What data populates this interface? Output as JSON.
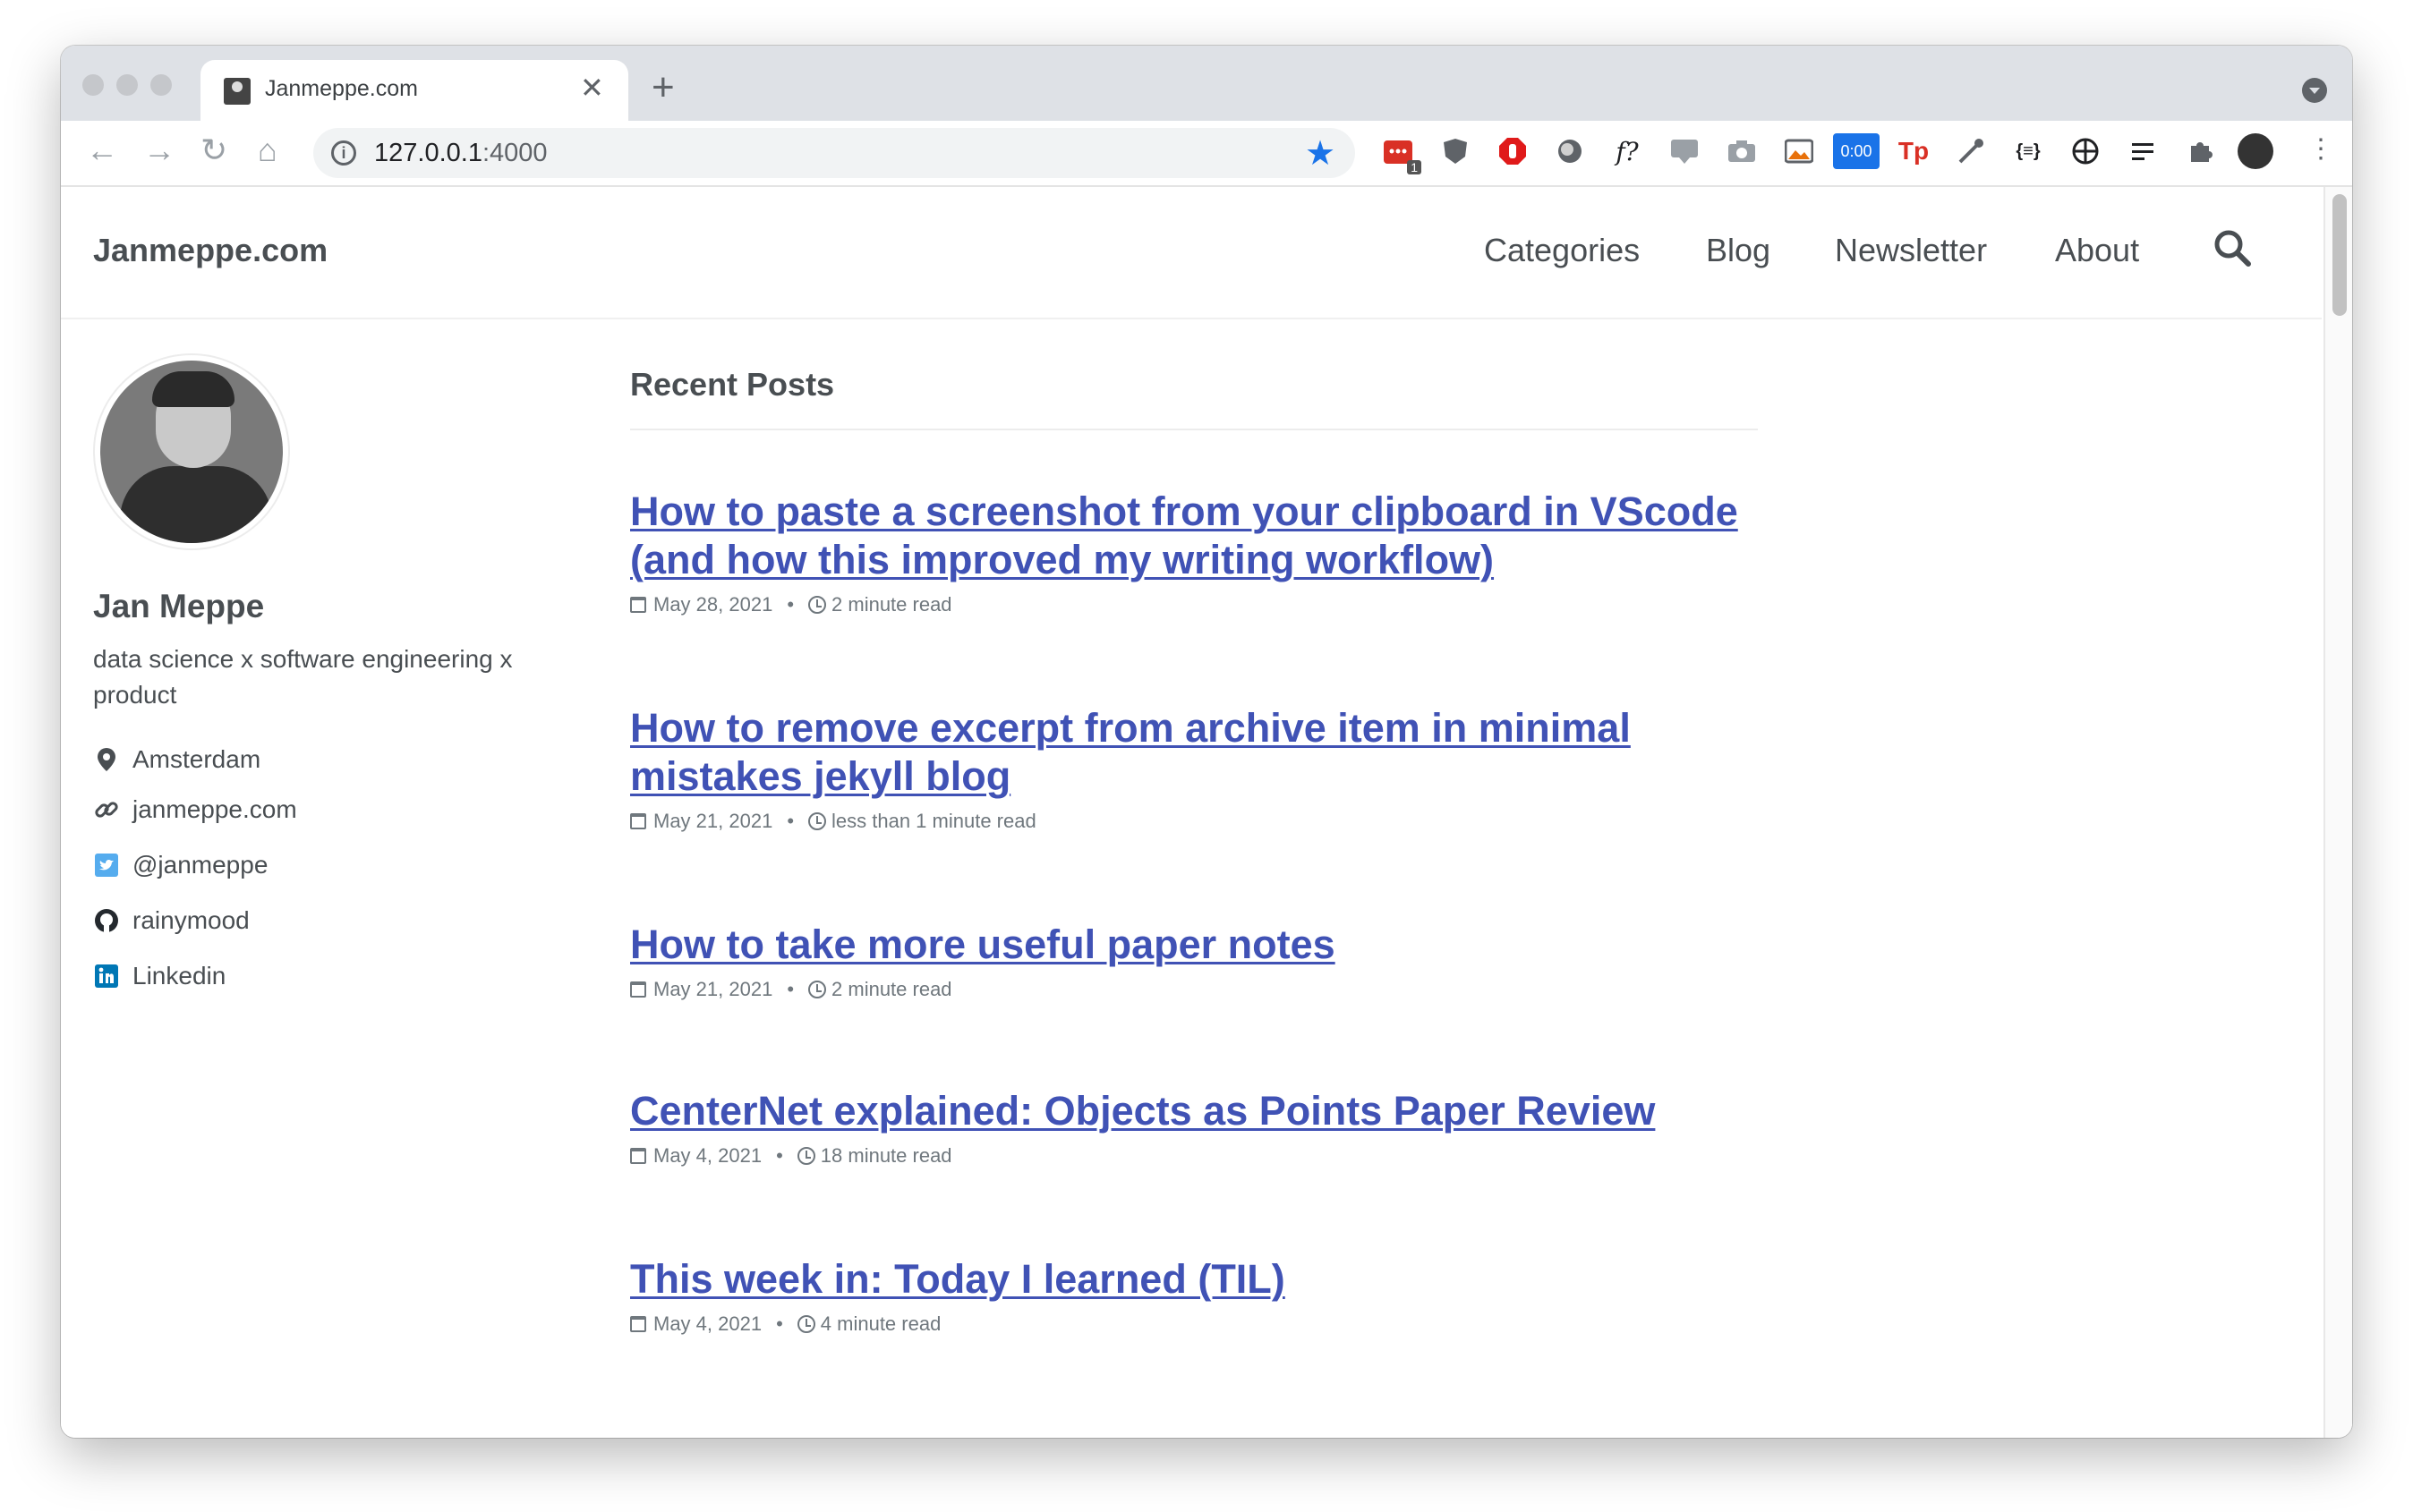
{
  "browser": {
    "tab_title": "Janmeppe.com",
    "url_host": "127.0.0.1",
    "url_port": ":4000",
    "new_tab_glyph": "+",
    "close_glyph": "✕",
    "extensions": [
      {
        "name": "calendar-ext-icon",
        "badge": "1"
      },
      {
        "name": "ublock-icon",
        "badge": ""
      },
      {
        "name": "adblock-icon",
        "badge": ""
      },
      {
        "name": "circle-ext-icon",
        "badge": ""
      },
      {
        "name": "font-finder-icon",
        "label": "f?"
      },
      {
        "name": "css-ext-icon",
        "badge": ""
      },
      {
        "name": "camera-icon",
        "badge": ""
      },
      {
        "name": "image-ext-icon",
        "badge": ""
      },
      {
        "name": "timer-ext-icon",
        "label": "0:00"
      },
      {
        "name": "tp-ext-icon",
        "label": "Tp"
      },
      {
        "name": "eyedropper-icon",
        "badge": ""
      },
      {
        "name": "json-ext-icon",
        "label": "{≡}"
      },
      {
        "name": "globe-ext-icon",
        "badge": ""
      },
      {
        "name": "reading-list-icon",
        "badge": ""
      },
      {
        "name": "puzzle-icon",
        "badge": ""
      }
    ],
    "colors": {
      "accent": "#1a73e8",
      "tabbar": "#dee1e6"
    }
  },
  "site": {
    "title": "Janmeppe.com",
    "nav": [
      "Categories",
      "Blog",
      "Newsletter",
      "About"
    ]
  },
  "author": {
    "name": "Jan Meppe",
    "bio": "data science x software engineering x product",
    "links": [
      {
        "icon": "location-pin-icon",
        "label": "Amsterdam"
      },
      {
        "icon": "link-icon",
        "label": "janmeppe.com"
      },
      {
        "icon": "twitter-icon",
        "label": "@janmeppe"
      },
      {
        "icon": "github-icon",
        "label": "rainymood"
      },
      {
        "icon": "linkedin-icon",
        "label": "Linkedin"
      }
    ]
  },
  "main": {
    "section_title": "Recent Posts",
    "posts": [
      {
        "title": "How to paste a screenshot from your clipboard in VScode (and how this improved my writing workflow)",
        "date": "May 28, 2021",
        "read_time": "2 minute read"
      },
      {
        "title": "How to remove excerpt from archive item in minimal mistakes jekyll blog",
        "date": "May 21, 2021",
        "read_time": "less than 1 minute read"
      },
      {
        "title": "How to take more useful paper notes",
        "date": "May 21, 2021",
        "read_time": "2 minute read"
      },
      {
        "title": "CenterNet explained: Objects as Points Paper Review",
        "date": "May 4, 2021",
        "read_time": "18 minute read"
      },
      {
        "title": "This week in: Today I learned (TIL)",
        "date": "May 4, 2021",
        "read_time": "4 minute read"
      }
    ],
    "colors": {
      "link": "#4052b5",
      "text": "#494e52"
    }
  }
}
